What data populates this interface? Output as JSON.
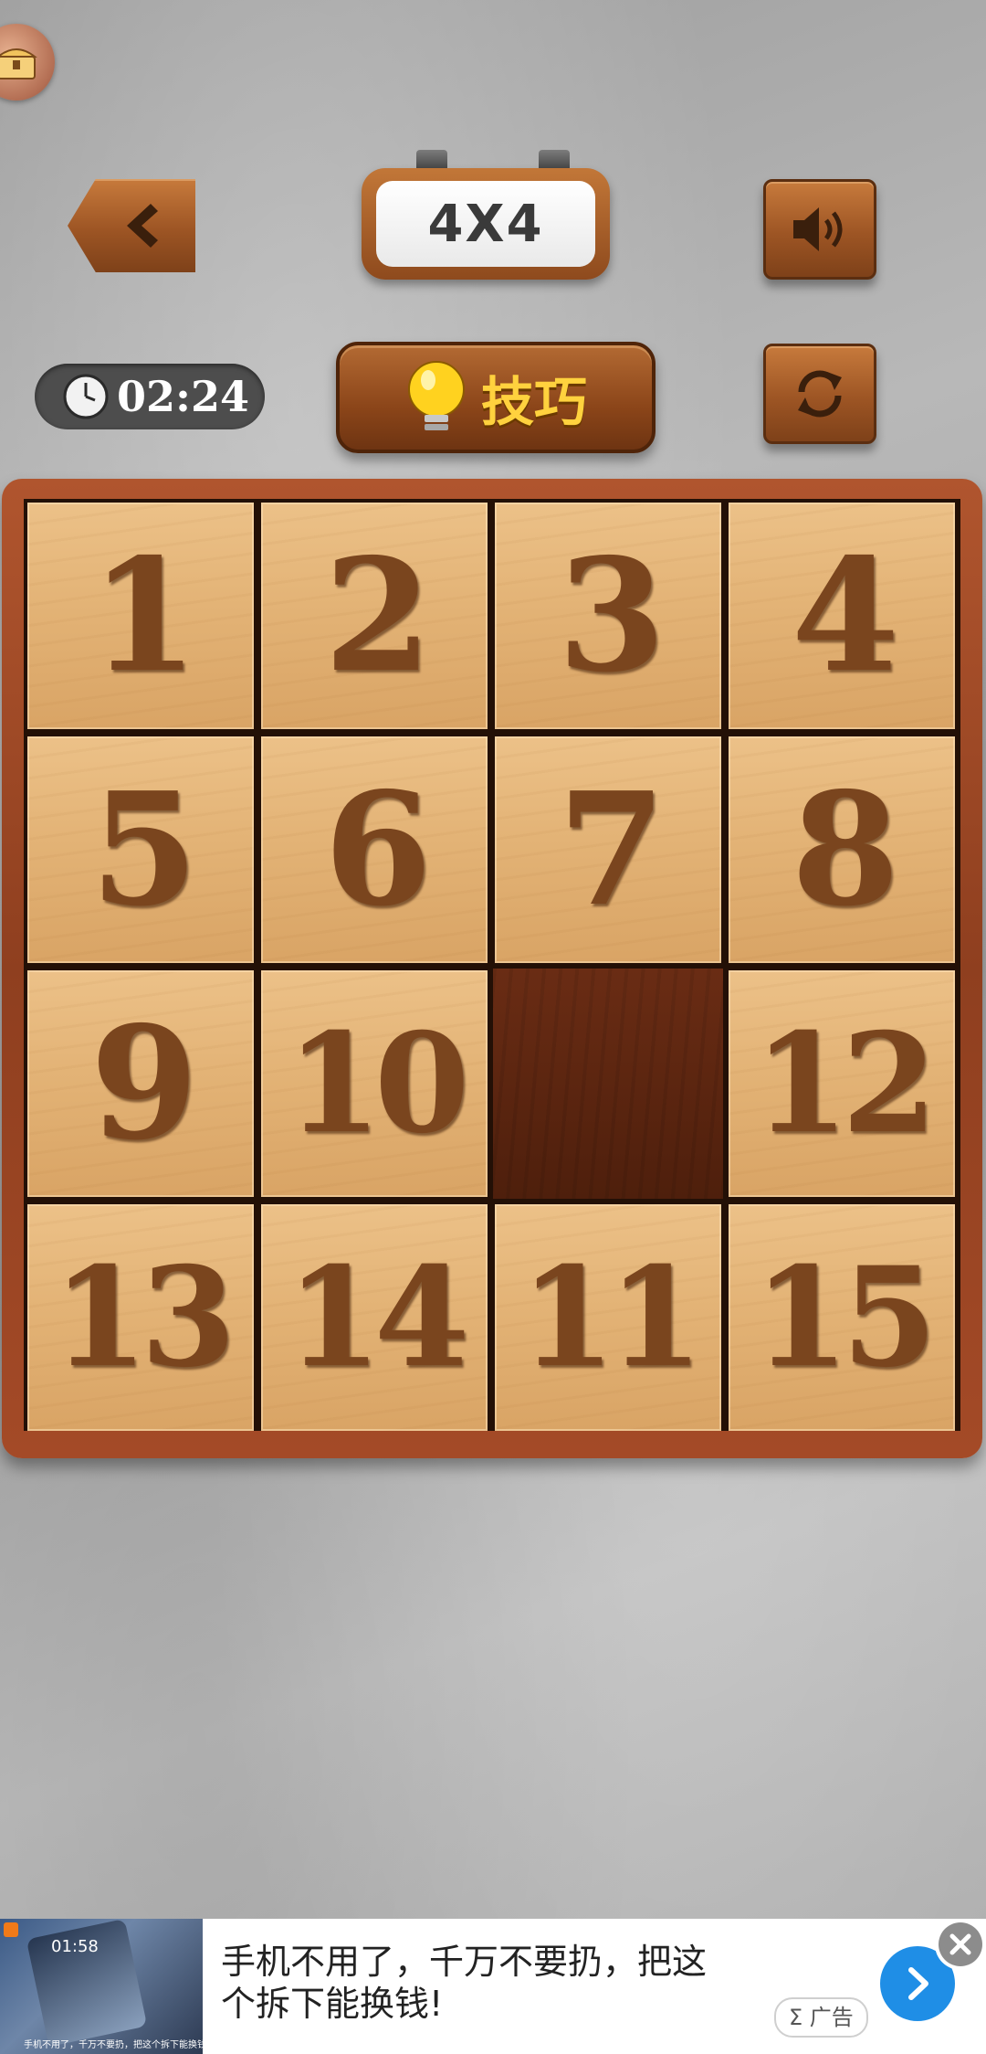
{
  "header": {
    "level_label": "4X4",
    "back_icon": "chevron-left-icon",
    "sound_icon": "speaker-icon",
    "refresh_icon": "refresh-icon"
  },
  "toolbar": {
    "timer": "02:24",
    "hint_label": "技巧",
    "hint_icon": "lightbulb-icon"
  },
  "board": {
    "rows": 4,
    "cols": 4,
    "tiles": [
      [
        "1",
        "2",
        "3",
        "4"
      ],
      [
        "5",
        "6",
        "7",
        "8"
      ],
      [
        "9",
        "10",
        "",
        "12"
      ],
      [
        "13",
        "14",
        "11",
        "15"
      ]
    ]
  },
  "ad": {
    "thumb_time": "01:58",
    "thumb_caption": "手机不用了，千万不要扔，把这个拆下能换钱！",
    "text_line1": "手机不用了，千万不要扔，把这",
    "text_line2": "个拆下能换钱!",
    "label": "Σ 广告",
    "go_icon": "chevron-right-icon",
    "close_icon": "close-icon"
  },
  "colors": {
    "wood_dark": "#5b2e10",
    "tile_light": "#e3b376",
    "number_brown": "#7a451e",
    "hint_yellow": "#ffd23e",
    "ad_blue": "#1f8ee6"
  }
}
